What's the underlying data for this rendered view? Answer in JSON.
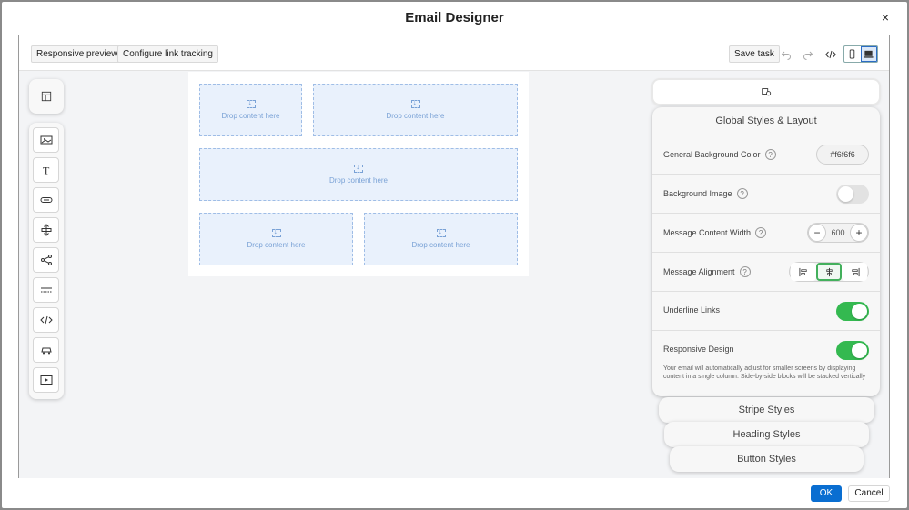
{
  "dialog": {
    "title": "Email Designer",
    "close_icon": "×"
  },
  "toolbar": {
    "responsive_previews": "Responsive previews",
    "configure_link_tracking": "Configure link tracking",
    "save_task": "Save task"
  },
  "canvas": {
    "drop_label": "Drop content here"
  },
  "panel": {
    "title": "Global Styles & Layout",
    "bg_color_label": "General Background Color",
    "bg_color_value": "#f6f6f6",
    "bg_image_label": "Background Image",
    "bg_image_enabled": false,
    "content_width_label": "Message Content Width",
    "content_width_value": "600",
    "alignment_label": "Message Alignment",
    "alignment_selected": "center",
    "underline_label": "Underline Links",
    "underline_enabled": true,
    "responsive_label": "Responsive Design",
    "responsive_enabled": true,
    "responsive_desc": "Your email will automatically adjust for smaller screens by displaying content in a single column. Side-by-side blocks will be stacked vertically",
    "help_glyph": "?"
  },
  "accordions": {
    "stripe": "Stripe Styles",
    "heading": "Heading Styles",
    "button": "Button Styles"
  },
  "footer": {
    "ok": "OK",
    "cancel": "Cancel"
  },
  "colors": {
    "primary": "#0a6ed1",
    "toggle_on": "#34b950",
    "drop_bg": "#e9f1fc"
  }
}
